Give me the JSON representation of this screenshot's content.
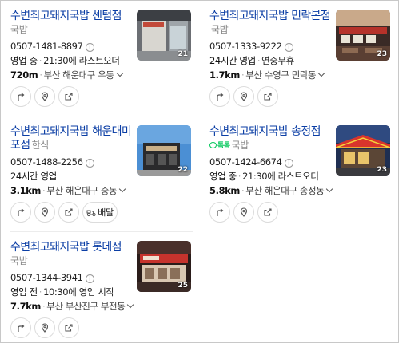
{
  "places": [
    {
      "name": "수변최고돼지국밥 센텀점",
      "category": "국밥",
      "phone": "0507-1481-8897",
      "status": "영업 중",
      "hours_text": "21:30에 라스트오더",
      "distance": "720m",
      "address": "부산 해운대구 우동",
      "photo_count": "21",
      "actions": [
        "directions",
        "save",
        "share"
      ]
    },
    {
      "name": "수변최고돼지국밥 민락본점",
      "category": "국밥",
      "phone": "0507-1333-9222",
      "status": "24시간 영업",
      "hours_text": "연중무휴",
      "distance": "1.7km",
      "address": "부산 수영구 민락동",
      "photo_count": "23",
      "actions": [
        "directions",
        "save",
        "share"
      ]
    },
    {
      "name": "수변최고돼지국밥 해운대미포점",
      "category": "한식",
      "phone": "0507-1488-2256",
      "status": "24시간 영업",
      "hours_text": "",
      "distance": "3.1km",
      "address": "부산 해운대구 중동",
      "photo_count": "22",
      "actions": [
        "directions",
        "save",
        "share"
      ],
      "delivery_label": "배달"
    },
    {
      "name": "수변최고돼지국밥 송정점",
      "badge": "톡톡",
      "category": "국밥",
      "phone": "0507-1424-6674",
      "status": "영업 중",
      "hours_text": "21:30에 라스트오더",
      "distance": "5.8km",
      "address": "부산 해운대구 송정동",
      "photo_count": "23",
      "actions": [
        "directions",
        "save",
        "share"
      ]
    },
    {
      "name": "수변최고돼지국밥 롯데점",
      "category": "국밥",
      "phone": "0507-1344-3941",
      "status": "영업 전",
      "hours_text": "10:30에 영업 시작",
      "distance": "7.7km",
      "address": "부산 부산진구 부전동",
      "photo_count": "25",
      "actions": [
        "directions",
        "save",
        "share"
      ]
    }
  ],
  "icons": {
    "directions": "directions-icon",
    "save": "map-pin-icon",
    "share": "share-icon",
    "delivery": "delivery-scooter-icon",
    "info": "info-icon",
    "expand": "chevron-down-icon"
  },
  "colors": {
    "title": "#0b3ea5",
    "talk_badge": "#03c75a"
  }
}
